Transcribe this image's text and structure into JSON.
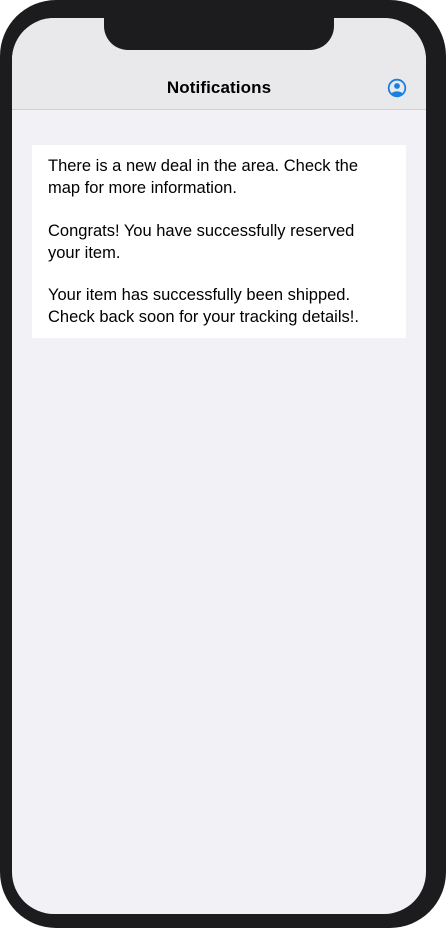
{
  "nav": {
    "title": "Notifications",
    "profile_icon": "person-circle-icon",
    "accent_color": "#1a7fe0"
  },
  "notifications": [
    {
      "text": "There is a new deal in the area. Check the map for more information."
    },
    {
      "text": "Congrats! You have successfully reserved your item."
    },
    {
      "text": "Your item has successfully been shipped. Check back soon for your tracking details!."
    }
  ]
}
